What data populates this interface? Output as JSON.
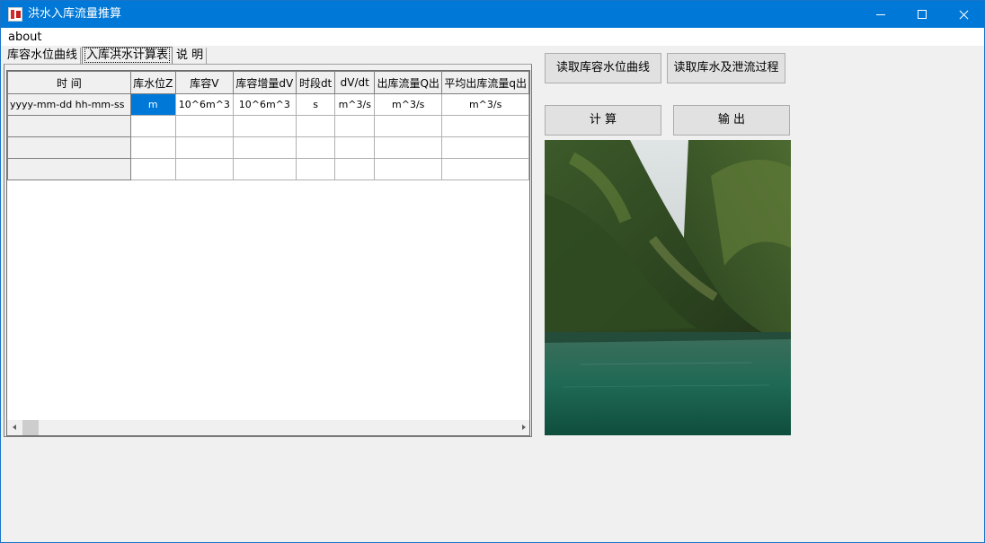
{
  "window": {
    "title": "洪水入库流量推算"
  },
  "menu": {
    "about": "about"
  },
  "tabs": [
    {
      "label": "库容水位曲线"
    },
    {
      "label": "入库洪水计算表"
    },
    {
      "label": "说 明"
    }
  ],
  "table": {
    "headers": [
      "时 间",
      "库水位Z",
      "库容V",
      "库容增量dV",
      "时段dt",
      "dV/dt",
      "出库流量Q出",
      "平均出库流量q出"
    ],
    "units": [
      "yyyy-mm-dd hh-mm-ss",
      "m",
      "10^6m^3",
      "10^6m^3",
      "s",
      "m^3/s",
      "m^3/s",
      "m^3/s"
    ],
    "selected_cell": "库水位Z",
    "empty_rows": 3
  },
  "buttons": {
    "read_curve": "读取库容水位曲线",
    "read_process": "读取库水及泄流过程",
    "compute": "计  算",
    "output": "输  出"
  },
  "image": {
    "description_icon": "mountain-lake-photo"
  },
  "colors": {
    "titlebar": "#0078d7",
    "selection": "#0078d7",
    "face": "#f0f0f0"
  }
}
